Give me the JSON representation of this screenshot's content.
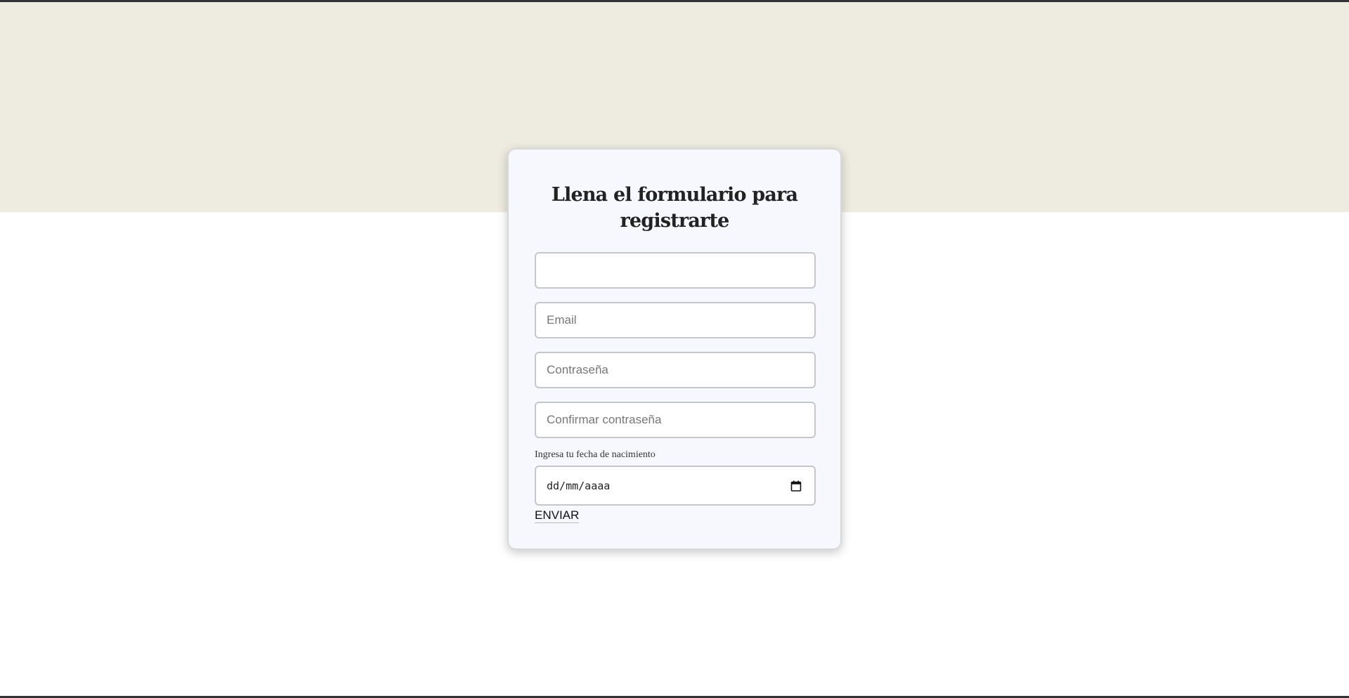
{
  "form": {
    "title": "Llena el formulario para registrarte",
    "fields": {
      "name": {
        "value": "",
        "placeholder": ""
      },
      "email": {
        "placeholder": "Email"
      },
      "password": {
        "placeholder": "Contraseña"
      },
      "confirm_password": {
        "placeholder": "Confirmar contraseña"
      }
    },
    "birthdate": {
      "label": "Ingresa tu fecha de nacimiento",
      "display": "dd/mm/aaaa",
      "icon": "calendar-icon"
    },
    "submit_label": "ENVIAR"
  },
  "colors": {
    "banner": "#eeebe0",
    "card": "#f7f8fd",
    "page": "#ffffff"
  }
}
